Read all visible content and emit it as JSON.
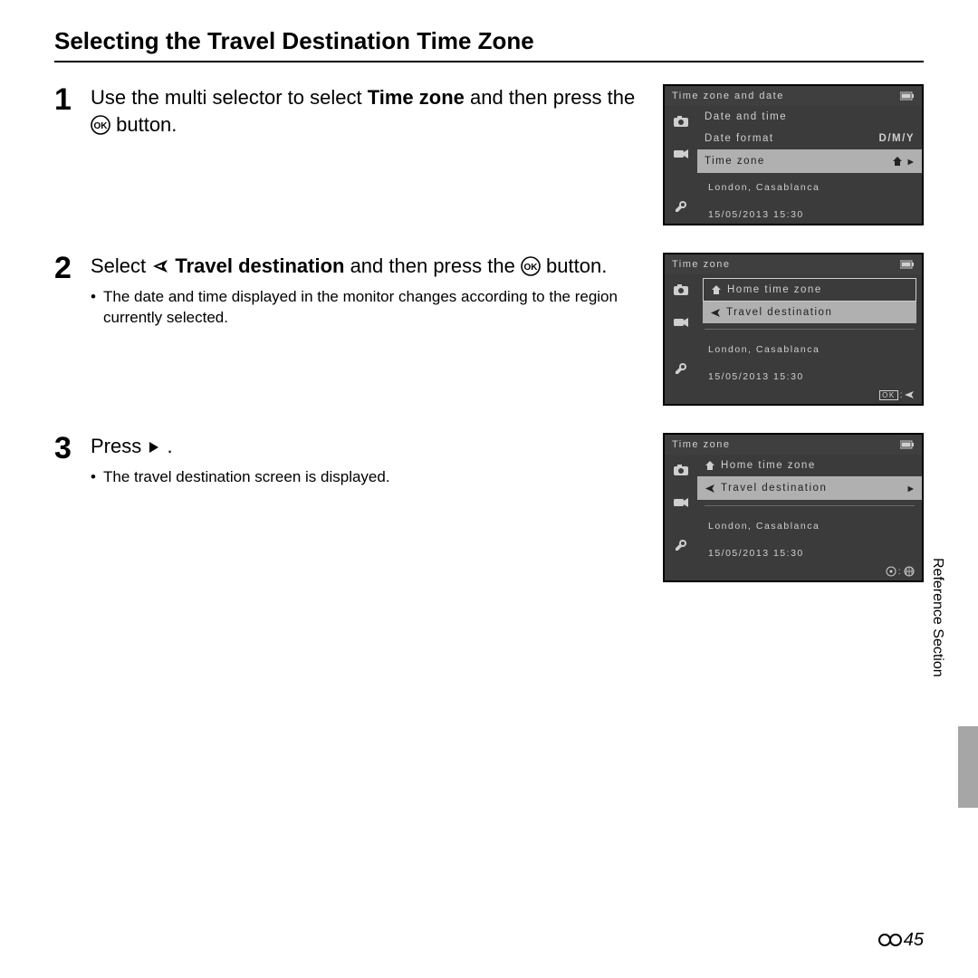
{
  "title": "Selecting the Travel Destination Time Zone",
  "section_label": "Reference Section",
  "page_number": "45",
  "steps": {
    "s1": {
      "num": "1",
      "t_a": "Use the multi selector to select ",
      "t_b": "Time zone",
      "t_c": " and then press the ",
      "t_d": " button."
    },
    "s2": {
      "num": "2",
      "t_a": "Select ",
      "t_b": " Travel destination",
      "t_c": " and then press the ",
      "t_d": " button.",
      "bullet": "The date and time displayed in the monitor changes according to the region currently selected."
    },
    "s3": {
      "num": "3",
      "t_a": "Press ",
      "t_b": ".",
      "bullet": "The travel destination screen is displayed."
    }
  },
  "lcd_common": {
    "location": "London, Casablanca",
    "timestamp": "15/05/2013   15:30"
  },
  "lcd1": {
    "title": "Time zone and date",
    "r1": "Date and time",
    "r2": "Date format",
    "r2v": "D/M/Y",
    "r3": "Time zone"
  },
  "lcd2": {
    "title": "Time zone",
    "r1": "Home time zone",
    "r2": "Travel destination",
    "foot_hint": "OK"
  },
  "lcd3": {
    "title": "Time zone",
    "r1": "Home time zone",
    "r2": "Travel destination"
  }
}
